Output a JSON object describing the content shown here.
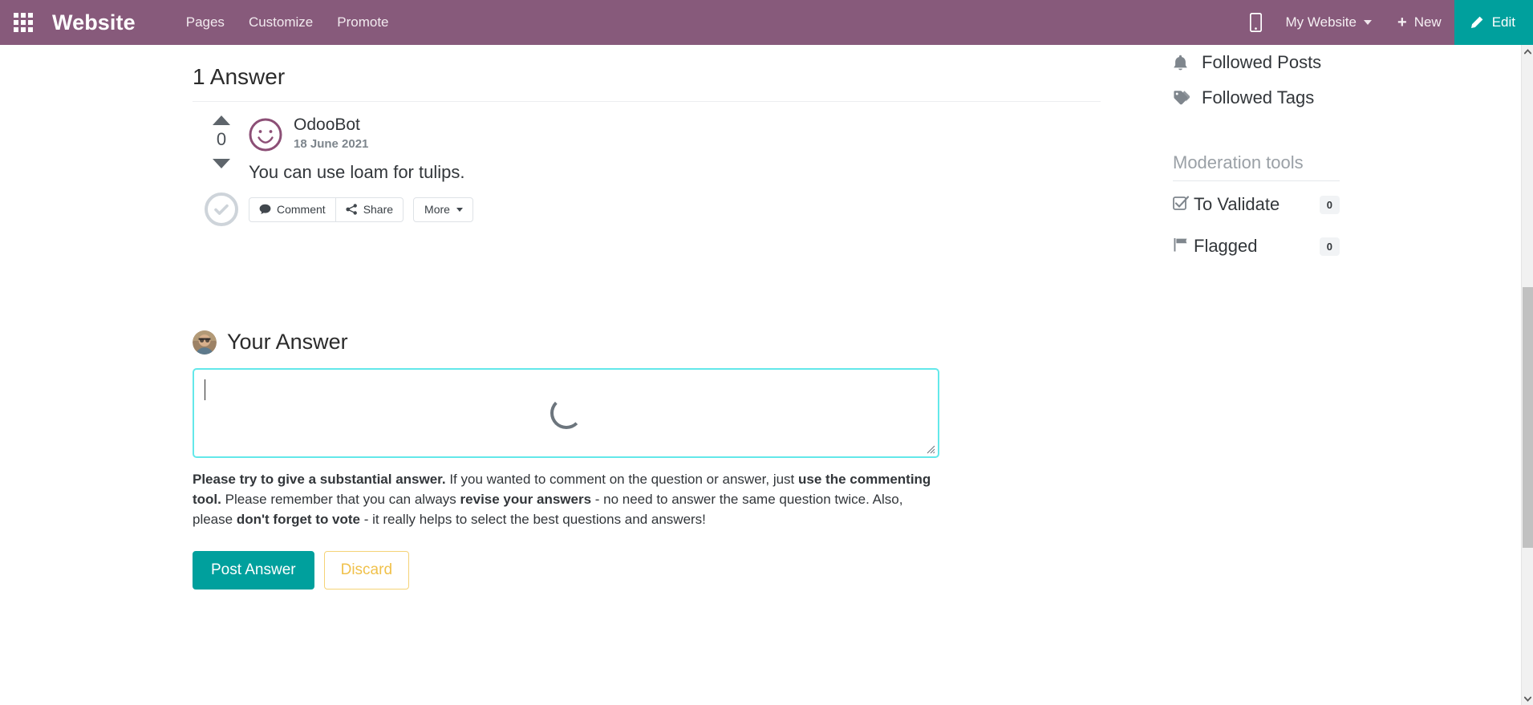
{
  "navbar": {
    "apps_icon": "apps-grid-icon",
    "brand": "Website",
    "links": [
      {
        "label": "Pages"
      },
      {
        "label": "Customize"
      },
      {
        "label": "Promote"
      }
    ],
    "mobile_preview_icon": "mobile-phone-icon",
    "website_selector": "My Website",
    "new_label": "New",
    "new_icon": "plus-icon",
    "edit_label": "Edit",
    "edit_icon": "pencil-icon",
    "bg_color": "#875A7B",
    "edit_bg_color": "#00A09D"
  },
  "main": {
    "answers_heading": "1 Answer",
    "answer": {
      "vote_count": "0",
      "author": "OdooBot",
      "date": "18 June 2021",
      "text": "You can use loam for tulips.",
      "actions": [
        {
          "label": "Comment",
          "icon": "comment-icon"
        },
        {
          "label": "Share",
          "icon": "share-icon"
        }
      ],
      "more_label": "More"
    },
    "your_answer": {
      "title": "Your Answer",
      "editor_placeholder": "",
      "editor_value": "",
      "loading": true
    },
    "hint": {
      "b1": "Please try to give a substantial answer.",
      "t1": " If you wanted to comment on the question or answer, just ",
      "b2": "use the commenting tool.",
      "t2": " Please remember that you can always ",
      "b3": "revise your answers",
      "t3": " - no need to answer the same question twice. Also, please ",
      "b4": "don't forget to vote",
      "t4": " - it really helps to select the best questions and answers!"
    },
    "post_answer_label": "Post Answer",
    "discard_label": "Discard"
  },
  "sidebar": {
    "links": [
      {
        "label": "Followed Posts",
        "icon": "bell-icon"
      },
      {
        "label": "Followed Tags",
        "icon": "tag-icon"
      }
    ],
    "moderation_title": "Moderation tools",
    "moderation_items": [
      {
        "label": "To Validate",
        "icon": "checkbox-checked-icon",
        "count": "0"
      },
      {
        "label": "Flagged",
        "icon": "flag-icon",
        "count": "0"
      }
    ]
  },
  "scrollbar": {
    "up_icon": "chevron-up-icon",
    "down_icon": "chevron-down-icon"
  }
}
